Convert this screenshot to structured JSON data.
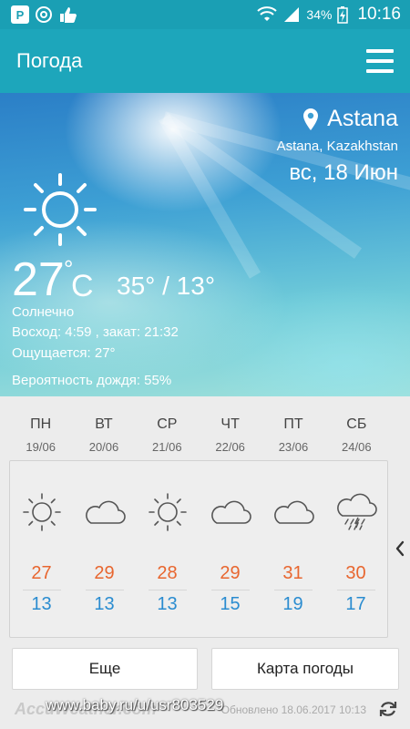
{
  "status_bar": {
    "battery": "34%",
    "time": "10:16",
    "app_letter": "P"
  },
  "app_bar": {
    "title": "Погода",
    "menu_icon": "hamburger-menu-icon"
  },
  "hero": {
    "city": "Astana",
    "region": "Astana, Kazakhstan",
    "date": "вс, 18 Июн",
    "temp": "27",
    "deg": "°",
    "unit": "C",
    "range": "35° / 13°",
    "condition": "Солнечно",
    "sunrise": "Восход: 4:59 , закат: 21:32",
    "feels": "Ощущается: 27°",
    "rain": "Вероятность дождя: 55%"
  },
  "forecast": [
    {
      "day": "ПН",
      "date": "19/06",
      "icon": "sun-icon",
      "high": "27",
      "low": "13"
    },
    {
      "day": "ВТ",
      "date": "20/06",
      "icon": "cloud-icon",
      "high": "29",
      "low": "13"
    },
    {
      "day": "СР",
      "date": "21/06",
      "icon": "sun-icon",
      "high": "28",
      "low": "13"
    },
    {
      "day": "ЧТ",
      "date": "22/06",
      "icon": "cloud-icon",
      "high": "29",
      "low": "15"
    },
    {
      "day": "ПТ",
      "date": "23/06",
      "icon": "cloud-icon",
      "high": "31",
      "low": "19"
    },
    {
      "day": "СБ",
      "date": "24/06",
      "icon": "rain-icon",
      "high": "30",
      "low": "17"
    }
  ],
  "buttons": {
    "more": "Еще",
    "map": "Карта погоды"
  },
  "footer": {
    "brand": "AccuWeather.com",
    "updated": "Обновлено 18.06.2017 10:13",
    "watermark": "www.baby.ru/u/usr803529"
  },
  "colors": {
    "accent": "#1da6bb",
    "high_temp": "#e8662f",
    "low_temp": "#2a8cd0"
  }
}
